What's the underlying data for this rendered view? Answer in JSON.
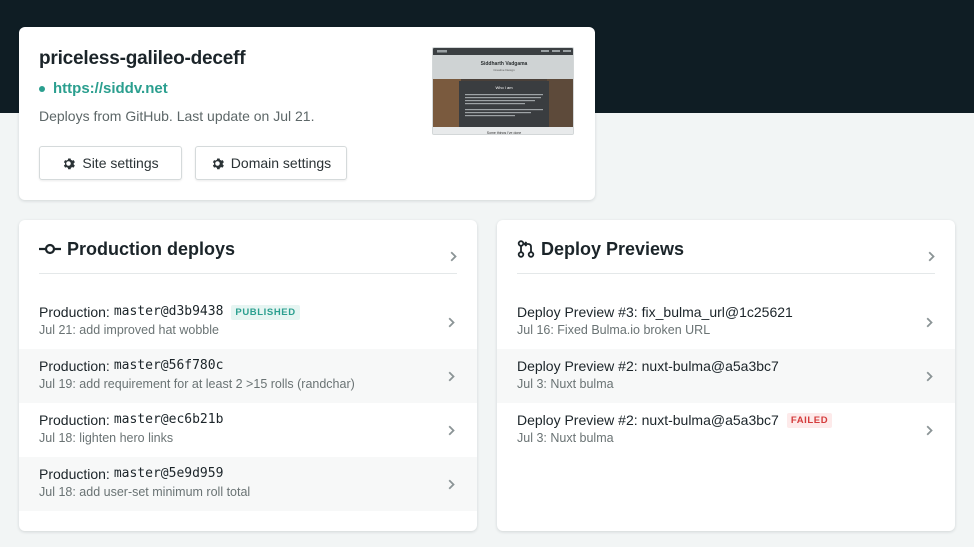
{
  "site": {
    "name": "priceless-galileo-deceff",
    "url": "https://siddv.net",
    "meta": "Deploys from GitHub. Last update on Jul 21.",
    "buttons": {
      "site_settings": "Site settings",
      "domain_settings": "Domain settings"
    },
    "thumbnail": {
      "heading": "Siddharth Vadgama",
      "subheading": "Creative Design",
      "section_title": "Who I am",
      "footer_text": "Some things I've done"
    }
  },
  "production": {
    "title": "Production deploys",
    "icon": "commit-icon",
    "rows": [
      {
        "kind": "Production:",
        "ref": "master@d3b9438",
        "badge": "PUBLISHED",
        "badge_type": "published",
        "sub": "Jul 21: add improved hat wobble"
      },
      {
        "kind": "Production:",
        "ref": "master@56f780c",
        "badge": "",
        "badge_type": "",
        "sub": "Jul 19: add requirement for at least 2 >15 rolls (randchar)"
      },
      {
        "kind": "Production:",
        "ref": "master@ec6b21b",
        "badge": "",
        "badge_type": "",
        "sub": "Jul 18: lighten hero links"
      },
      {
        "kind": "Production:",
        "ref": "master@5e9d959",
        "badge": "",
        "badge_type": "",
        "sub": "Jul 18: add user-set minimum roll total"
      }
    ]
  },
  "previews": {
    "title": "Deploy Previews",
    "icon": "pull-request-icon",
    "rows": [
      {
        "kind": "Deploy Preview #3:",
        "ref": "fix_bulma_url@1c25621",
        "badge": "",
        "badge_type": "",
        "sub": "Jul 16: Fixed Bulma.io broken URL"
      },
      {
        "kind": "Deploy Preview #2:",
        "ref": "nuxt-bulma@a5a3bc7",
        "badge": "",
        "badge_type": "",
        "sub": "Jul 3: Nuxt bulma"
      },
      {
        "kind": "Deploy Preview #2:",
        "ref": "nuxt-bulma@a5a3bc7",
        "badge": "FAILED",
        "badge_type": "failed",
        "sub": "Jul 3: Nuxt bulma"
      }
    ]
  },
  "colors": {
    "top_band": "#0f1d24",
    "accent": "#2b9f8f",
    "failed": "#d43b3b",
    "background": "#f2f5f5"
  }
}
